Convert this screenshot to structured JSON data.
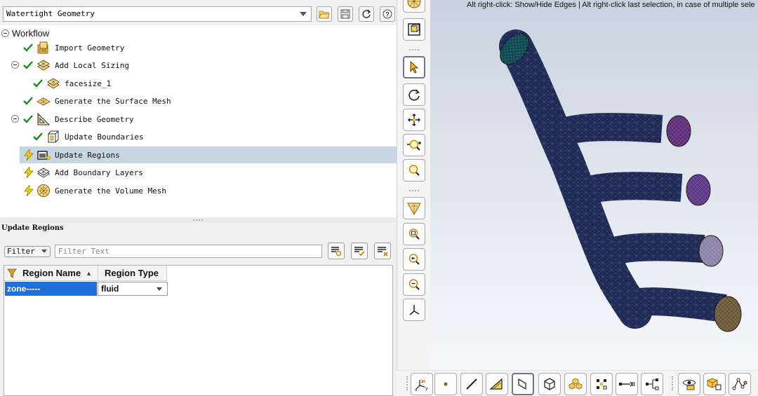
{
  "workflow_selector": {
    "value": "Watertight Geometry"
  },
  "workflow_tree": {
    "root_label": "Workflow",
    "items": [
      {
        "label": "Import Geometry",
        "status": "done"
      },
      {
        "label": "Add Local Sizing",
        "status": "done"
      },
      {
        "label": "facesize_1",
        "status": "done"
      },
      {
        "label": "Generate the Surface Mesh",
        "status": "done"
      },
      {
        "label": "Describe Geometry",
        "status": "done"
      },
      {
        "label": "Update Boundaries",
        "status": "done"
      },
      {
        "label": "Update Regions",
        "status": "pending",
        "selected": true
      },
      {
        "label": "Add Boundary Layers",
        "status": "pending"
      },
      {
        "label": "Generate the Volume Mesh",
        "status": "pending"
      }
    ]
  },
  "task_panel": {
    "title": "Update Regions",
    "filter": {
      "combo_label": "Filter",
      "placeholder": "Filter Text"
    },
    "table": {
      "columns": [
        "Region Name",
        "Region Type"
      ],
      "rows": [
        {
          "name": "zone-----",
          "type": "fluid"
        }
      ]
    }
  },
  "viewport": {
    "hint": "Alt right-click: Show/Hide Edges | Alt right-click last selection, in case of multiple sele",
    "colors": {
      "mesh": "#1c2752",
      "inlet": "#0d4750",
      "outlet_1": "#5d2d78",
      "outlet_2": "#5d3788",
      "outlet_3": "#8a83a6",
      "outlet_4": "#6b5838"
    }
  },
  "colors": {
    "selection_row": "#c8d5e3",
    "selected_cell": "#1e6fd8",
    "check": "#1a8a1a",
    "bolt": "#f2d200"
  }
}
